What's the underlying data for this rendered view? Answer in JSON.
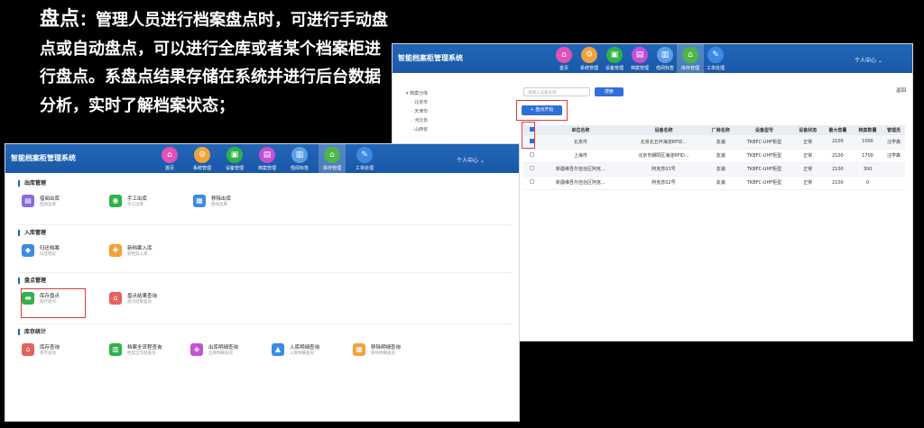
{
  "caption": {
    "keyword": "盘点",
    "text": "：管理人员进行档案盘点时，可进行手动盘点或自动盘点，可以进行全库或者某个档案柜进行盘点。系盘点结果存储在系统并进行后台数据分析，实时了解档案状态；"
  },
  "app_title": "智能档案柜管理系统",
  "user_menu": "个人中心 ⌄",
  "nav": [
    {
      "label": "首页",
      "icon": "home-icon",
      "glyph": "⌂",
      "color": "#e052b5"
    },
    {
      "label": "系统管理",
      "icon": "settings-icon",
      "glyph": "⚙",
      "color": "#f2a23a"
    },
    {
      "label": "设备管理",
      "icon": "device-icon",
      "glyph": "▣",
      "color": "#2fb34a"
    },
    {
      "label": "档案管理",
      "icon": "archive-icon",
      "glyph": "▤",
      "color": "#c64fd8"
    },
    {
      "label": "借阅标签",
      "icon": "borrow-icon",
      "glyph": "▥",
      "color": "#5aa0e8"
    },
    {
      "label": "库存管理",
      "icon": "inventory-icon",
      "glyph": "⌂",
      "color": "#4cb648"
    },
    {
      "label": "工单处理",
      "icon": "workorder-icon",
      "glyph": "✎",
      "color": "#3d8ae6"
    }
  ],
  "inventory_page": {
    "tree_title": "▾ 档案分库",
    "tree": [
      "· 北京市",
      "· 天津市",
      "· 河北省",
      "· 山西省"
    ],
    "search_placeholder": "请输入设备名称",
    "search_label": "搜索",
    "back_label": "返回",
    "add_label": "+ 盘点开始",
    "columns": [
      "单位名称",
      "设备名称",
      "厂商名称",
      "设备型号",
      "设备状态",
      "最大容量",
      "档案数量",
      "管理员"
    ],
    "rows": [
      {
        "checked": true,
        "cells": [
          "北京市",
          "北京北五环海淀RFID...",
          "友浦",
          "TKBFC-UHF柜型",
          "正常",
          "2100",
          "1000",
          "汪学森"
        ]
      },
      {
        "checked": false,
        "cells": [
          "上海市",
          "北京市朝阳区海淀RFID...",
          "友浦",
          "TKBFC-UHF柜型",
          "正常",
          "2100",
          "1700",
          "汪学森"
        ]
      },
      {
        "checked": false,
        "cells": [
          "新疆维吾尔自治区阿克...",
          "阿克苏01号",
          "友浦",
          "TKBFC-UHF柜型",
          "正常",
          "2100",
          "300",
          ""
        ]
      },
      {
        "checked": false,
        "cells": [
          "新疆维吾尔自治区阿克...",
          "阿克苏02号",
          "友浦",
          "TKBFC-UHF柜型",
          "正常",
          "2100",
          "0",
          ""
        ]
      }
    ]
  },
  "home_page": {
    "sections": [
      {
        "title": "出库管理",
        "cards": [
          {
            "title": "借阅出库",
            "sub": "借阅出库",
            "icon": "borrow-out-icon",
            "glyph": "▤",
            "color": "#8a6be0"
          },
          {
            "title": "手工出库",
            "sub": "手工出库",
            "icon": "manual-out-icon",
            "glyph": "◉",
            "color": "#2fb34a"
          },
          {
            "title": "移除出库",
            "sub": "移除出库",
            "icon": "remove-out-icon",
            "glyph": "▦",
            "color": "#3d8ae6"
          }
        ]
      },
      {
        "title": "入库管理",
        "cards": [
          {
            "title": "归还档案",
            "sub": "归还档案",
            "icon": "return-icon",
            "glyph": "◆",
            "color": "#3d8ae6"
          },
          {
            "title": "新档案入库",
            "sub": "新档案入库",
            "icon": "new-archive-icon",
            "glyph": "✚",
            "color": "#f2a23a"
          }
        ]
      },
      {
        "title": "盘点管理",
        "cards": [
          {
            "title": "库存盘点",
            "sub": "库存盘点",
            "icon": "stocktake-icon",
            "glyph": "▬",
            "color": "#2fb34a"
          },
          {
            "title": "盘点结果查询",
            "sub": "盘点结果查询",
            "icon": "result-query-icon",
            "glyph": "⌂",
            "color": "#e5635d"
          }
        ]
      },
      {
        "title": "库存统计",
        "cards": [
          {
            "title": "库存查询",
            "sub": "库存查询",
            "icon": "stock-query-icon",
            "glyph": "⌂",
            "color": "#e5635d"
          },
          {
            "title": "档案全流程查询",
            "sub": "档案全流程查询",
            "icon": "process-query-icon",
            "glyph": "▥",
            "color": "#2fb34a"
          },
          {
            "title": "出库明细查询",
            "sub": "出库明细查询",
            "icon": "out-detail-icon",
            "glyph": "◈",
            "color": "#c64fd8"
          },
          {
            "title": "入库明细查询",
            "sub": "入库明细查询",
            "icon": "in-detail-icon",
            "glyph": "▲",
            "color": "#3d8ae6"
          },
          {
            "title": "移除明细查询",
            "sub": "移除明细查询",
            "icon": "remove-detail-icon",
            "glyph": "▦",
            "color": "#f2a23a"
          }
        ]
      }
    ]
  }
}
